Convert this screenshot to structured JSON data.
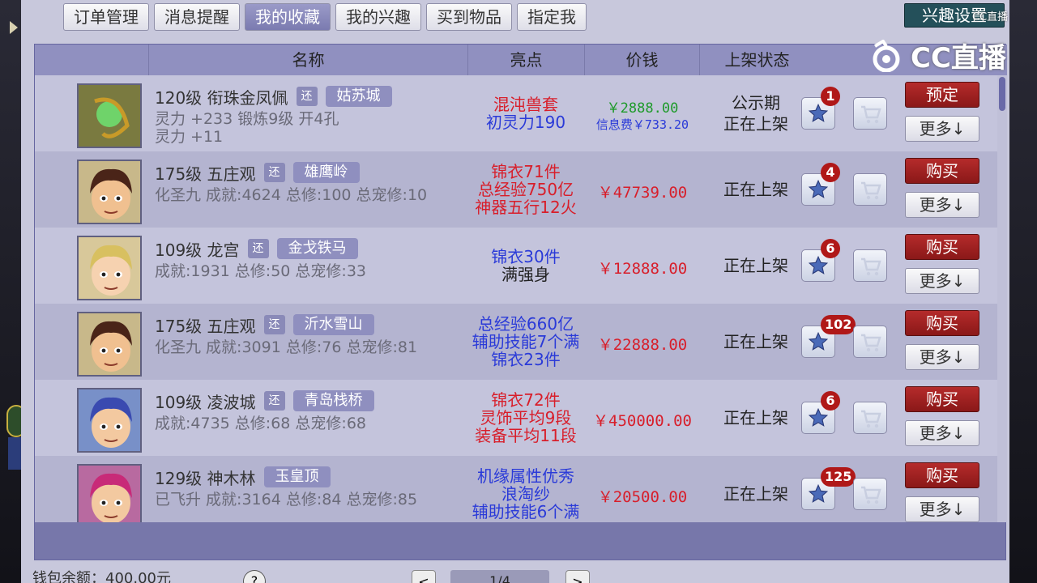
{
  "tabs": [
    "订单管理",
    "消息提醒",
    "我的收藏",
    "我的兴趣",
    "买到物品",
    "指定我"
  ],
  "active_tab": 2,
  "interest_button": "兴趣设置",
  "watermark": {
    "logo_text": "CC直播",
    "small_text": "CC直播"
  },
  "columns": {
    "name": "名称",
    "highlight": "亮点",
    "price": "价钱",
    "status": "上架状态"
  },
  "rows": [
    {
      "level_school": "120级  衔珠金凤佩",
      "huan": "还",
      "server": "姑苏城",
      "line2": "灵力 +233  锻炼9级  开4孔",
      "line3": "灵力 +11",
      "highlights": [
        {
          "text": "混沌兽套",
          "color": "#d81e2a"
        },
        {
          "text": "初灵力190",
          "color": "#2a3ad8"
        }
      ],
      "price": "￥2888.00",
      "price_color": "#1e9a2a",
      "fee": "信息费￥733.20",
      "status": [
        "公示期",
        "正在上架"
      ],
      "fav_count": "1",
      "action": "预定",
      "more": "更多↓",
      "avatar": "item"
    },
    {
      "level_school": "175级  五庄观",
      "huan": "还",
      "server": "雄鹰岭",
      "line2": "化圣九  成就:4624  总修:100  总宠修:10",
      "line3": "",
      "highlights": [
        {
          "text": "锦衣71件",
          "color": "#d81e2a"
        },
        {
          "text": "总经验750亿",
          "color": "#d81e2a"
        },
        {
          "text": "神器五行12火",
          "color": "#d81e2a"
        }
      ],
      "price": "￥47739.00",
      "price_color": "#d81e2a",
      "fee": "",
      "status": [
        "正在上架"
      ],
      "fav_count": "4",
      "action": "购买",
      "more": "更多↓",
      "avatar": "man"
    },
    {
      "level_school": "109级  龙宫",
      "huan": "还",
      "server": "金戈铁马",
      "line2": "成就:1931  总修:50  总宠修:33",
      "line3": "",
      "highlights": [
        {
          "text": "锦衣30件",
          "color": "#2a3ad8"
        },
        {
          "text": "满强身",
          "color": "#222222"
        }
      ],
      "price": "￥12888.00",
      "price_color": "#d81e2a",
      "fee": "",
      "status": [
        "正在上架"
      ],
      "fav_count": "6",
      "action": "购买",
      "more": "更多↓",
      "avatar": "girl"
    },
    {
      "level_school": "175级  五庄观",
      "huan": "还",
      "server": "沂水雪山",
      "line2": "化圣九  成就:3091  总修:76  总宠修:81",
      "line3": "",
      "highlights": [
        {
          "text": "总经验660亿",
          "color": "#2a3ad8"
        },
        {
          "text": "辅助技能7个满",
          "color": "#2a3ad8"
        },
        {
          "text": "锦衣23件",
          "color": "#2a3ad8"
        }
      ],
      "price": "￥22888.00",
      "price_color": "#d81e2a",
      "fee": "",
      "status": [
        "正在上架"
      ],
      "fav_count": "102",
      "action": "购买",
      "more": "更多↓",
      "avatar": "man"
    },
    {
      "level_school": "109级  凌波城",
      "huan": "还",
      "server": "青岛栈桥",
      "line2": "成就:4735  总修:68  总宠修:68",
      "line3": "",
      "highlights": [
        {
          "text": "锦衣72件",
          "color": "#d81e2a"
        },
        {
          "text": "灵饰平均9段",
          "color": "#d81e2a"
        },
        {
          "text": "装备平均11段",
          "color": "#d81e2a"
        }
      ],
      "price": "￥450000.00",
      "price_color": "#d81e2a",
      "fee": "",
      "status": [
        "正在上架"
      ],
      "fav_count": "6",
      "action": "购买",
      "more": "更多↓",
      "avatar": "blue"
    },
    {
      "level_school": "129级  神木林",
      "huan": "",
      "server": "玉皇顶",
      "line2": "已飞升  成就:3164  总修:84  总宠修:85",
      "line3": "",
      "highlights": [
        {
          "text": "机缘属性优秀",
          "color": "#2a3ad8"
        },
        {
          "text": "浪淘纱",
          "color": "#2a3ad8"
        },
        {
          "text": "辅助技能6个满",
          "color": "#2a3ad8"
        }
      ],
      "price": "￥20500.00",
      "price_color": "#d81e2a",
      "fee": "",
      "status": [
        "正在上架"
      ],
      "fav_count": "125",
      "action": "购买",
      "more": "更多↓",
      "avatar": "pink"
    }
  ],
  "footer": {
    "wallet": "钱包余额：400.00元",
    "help": "?",
    "page": "1/4",
    "prev": "<",
    "next": ">"
  }
}
